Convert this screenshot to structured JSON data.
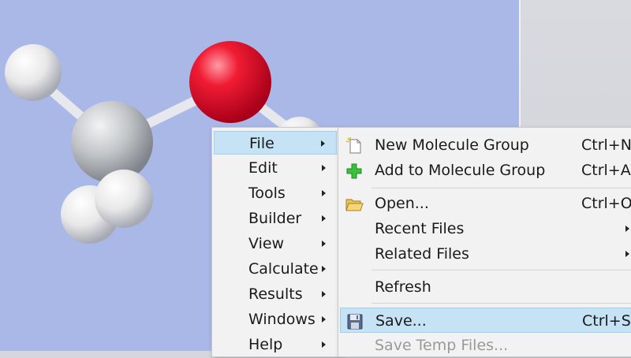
{
  "main_menu": {
    "items": [
      {
        "label": "File",
        "has_submenu": true,
        "active": true
      },
      {
        "label": "Edit",
        "has_submenu": true
      },
      {
        "label": "Tools",
        "has_submenu": true
      },
      {
        "label": "Builder",
        "has_submenu": true
      },
      {
        "label": "View",
        "has_submenu": true
      },
      {
        "label": "Calculate",
        "has_submenu": true
      },
      {
        "label": "Results",
        "has_submenu": true
      },
      {
        "label": "Windows",
        "has_submenu": true
      },
      {
        "label": "Help",
        "has_submenu": true
      }
    ]
  },
  "file_menu": {
    "items": [
      {
        "label": "New Molecule Group",
        "shortcut": "Ctrl+N",
        "icon": "new-document-icon"
      },
      {
        "label": "Add to Molecule Group",
        "shortcut": "Ctrl+A",
        "icon": "green-plus-icon"
      },
      {
        "label": "Open...",
        "shortcut": "Ctrl+O",
        "icon": "open-folder-icon"
      },
      {
        "label": "Recent Files",
        "has_submenu": true
      },
      {
        "label": "Related Files",
        "has_submenu": true
      },
      {
        "label": "Refresh"
      },
      {
        "label": "Save...",
        "shortcut": "Ctrl+S",
        "icon": "floppy-disk-icon",
        "active": true
      },
      {
        "label": "Save Temp Files...",
        "disabled": true
      }
    ]
  },
  "molecule": {
    "atom_colors": {
      "hydrogen": "#f4f4f4",
      "carbon": "#c3c6c9",
      "oxygen": "#e8102a"
    }
  },
  "colors": {
    "viewport_background": "#aab8e8",
    "menu_background": "#f2f2f2",
    "highlight": "#c6e3f5"
  }
}
